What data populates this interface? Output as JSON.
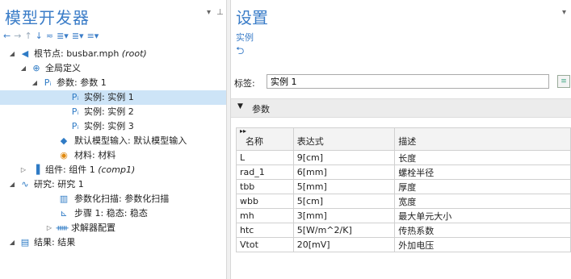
{
  "left": {
    "title": "模型开发器",
    "tree": [
      {
        "label": "根节点: busbar.mph",
        "italic": "(root)"
      },
      {
        "label": "全局定义",
        "italic": ""
      },
      {
        "label": "参数: 参数 1",
        "italic": ""
      },
      {
        "label": "实例: 实例 1",
        "italic": ""
      },
      {
        "label": "实例: 实例 2",
        "italic": ""
      },
      {
        "label": "实例: 实例 3",
        "italic": ""
      },
      {
        "label": "默认模型输入: 默认模型输入",
        "italic": ""
      },
      {
        "label": "材料: 材料",
        "italic": ""
      },
      {
        "label": "组件: 组件 1",
        "italic": "(comp1)"
      },
      {
        "label": "研究: 研究 1",
        "italic": ""
      },
      {
        "label": "参数化扫描: 参数化扫描",
        "italic": ""
      },
      {
        "label": "步骤 1: 稳态: 稳态",
        "italic": ""
      },
      {
        "label": "求解器配置",
        "italic": ""
      },
      {
        "label": "结果: 结果",
        "italic": ""
      }
    ]
  },
  "right": {
    "title": "设置",
    "subtitle": "实例",
    "label_key": "标签:",
    "label_value": "实例 1",
    "section": "参数",
    "table": {
      "headers": [
        "名称",
        "表达式",
        "描述"
      ],
      "rows": [
        [
          "L",
          "9[cm]",
          "长度"
        ],
        [
          "rad_1",
          "6[mm]",
          "螺栓半径"
        ],
        [
          "tbb",
          "5[mm]",
          "厚度"
        ],
        [
          "wbb",
          "5[cm]",
          "宽度"
        ],
        [
          "mh",
          "3[mm]",
          "最大单元大小"
        ],
        [
          "htc",
          "5[W/m^2/K]",
          "传热系数"
        ],
        [
          "Vtot",
          "20[mV]",
          "外加电压"
        ]
      ]
    }
  },
  "colors": {
    "accent": "#3b7dc8",
    "selection": "#cde4f7"
  }
}
